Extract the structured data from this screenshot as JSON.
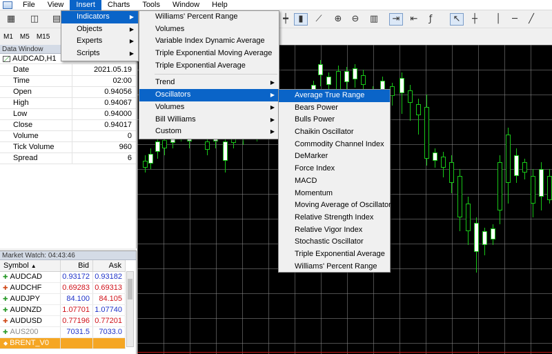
{
  "menubar": {
    "items": [
      {
        "label": "File"
      },
      {
        "label": "View"
      },
      {
        "label": "Insert"
      },
      {
        "label": "Charts"
      },
      {
        "label": "Tools"
      },
      {
        "label": "Window"
      },
      {
        "label": "Help"
      }
    ]
  },
  "timeframes": [
    "M1",
    "M5",
    "M15"
  ],
  "data_window": {
    "title": "Data Window",
    "symbol": "AUDCAD,H1",
    "rows": [
      {
        "key": "Date",
        "value": "2021.05.19"
      },
      {
        "key": "Time",
        "value": "02:00"
      },
      {
        "key": "Open",
        "value": "0.94056"
      },
      {
        "key": "High",
        "value": "0.94067"
      },
      {
        "key": "Low",
        "value": "0.94000"
      },
      {
        "key": "Close",
        "value": "0.94017"
      },
      {
        "key": "Volume",
        "value": "0"
      },
      {
        "key": "Tick Volume",
        "value": "960"
      },
      {
        "key": "Spread",
        "value": "6"
      }
    ]
  },
  "market_watch": {
    "title": "Market Watch: 04:43:46",
    "columns": {
      "symbol": "Symbol",
      "bid": "Bid",
      "ask": "Ask"
    },
    "rows": [
      {
        "symbol": "AUDCAD",
        "bid": "0.93172",
        "ask": "0.93182"
      },
      {
        "symbol": "AUDCHF",
        "bid": "0.69283",
        "ask": "0.69313"
      },
      {
        "symbol": "AUDJPY",
        "bid": "84.100",
        "ask": "84.105"
      },
      {
        "symbol": "AUDNZD",
        "bid": "1.07701",
        "ask": "1.07740"
      },
      {
        "symbol": "AUDUSD",
        "bid": "0.77196",
        "ask": "0.77201"
      },
      {
        "symbol": "AUS200",
        "bid": "7031.5",
        "ask": "7033.0"
      },
      {
        "symbol": "BRENT_V0",
        "bid": "",
        "ask": ""
      }
    ]
  },
  "insert_menu": {
    "items": [
      {
        "label": "Indicators",
        "submenu": true
      },
      {
        "label": "Objects",
        "submenu": true
      },
      {
        "label": "Experts",
        "submenu": true
      },
      {
        "label": "Scripts",
        "submenu": true
      }
    ]
  },
  "indicators_menu": {
    "top": [
      "Williams' Percent Range",
      "Volumes",
      "Variable Index Dynamic Average",
      "Triple Exponential Moving Average",
      "Triple Exponential Average"
    ],
    "groups": [
      {
        "label": "Trend"
      },
      {
        "label": "Oscillators"
      },
      {
        "label": "Volumes"
      },
      {
        "label": "Bill Williams"
      },
      {
        "label": "Custom"
      }
    ]
  },
  "oscillators_menu": {
    "items": [
      "Average True Range",
      "Bears Power",
      "Bulls Power",
      "Chaikin Oscillator",
      "Commodity Channel Index",
      "DeMarker",
      "Force Index",
      "MACD",
      "Momentum",
      "Moving Average of Oscillator",
      "Relative Strength Index",
      "Relative Vigor Index",
      "Stochastic Oscillator",
      "Triple Exponential Average",
      "Williams' Percent Range"
    ]
  },
  "colors": {
    "menu_highlight": "#0a64c8",
    "candle": "#18c818",
    "bid_ask_up": "#1f33c9",
    "bid_ask_down": "#d0121a",
    "highlight_row": "#f5a623"
  }
}
